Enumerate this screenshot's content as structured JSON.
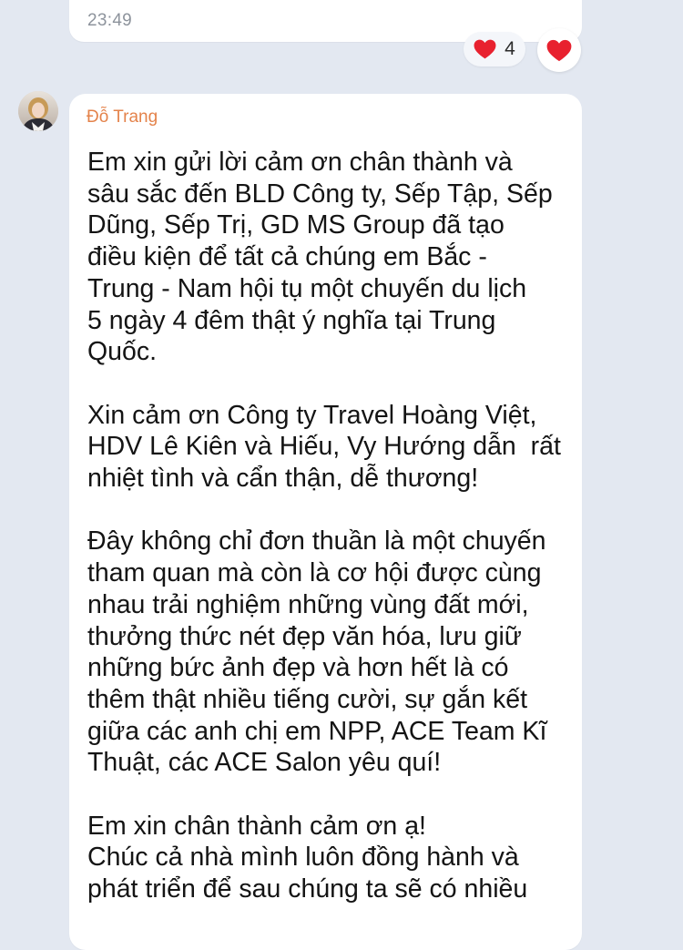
{
  "previous_message": {
    "time": "23:49",
    "reaction": {
      "emoji": "❤",
      "count": "4"
    }
  },
  "message": {
    "sender": "Đỗ Trang",
    "text": "Em xin gửi lời cảm ơn chân thành và\nsâu sắc đến BLD Công ty, Sếp Tập, Sếp\nDũng, Sếp Trị, GD MS Group đã tạo\nđiều kiện để tất cả chúng em Bắc -\nTrung - Nam hội tụ một chuyến du lịch\n5 ngày 4 đêm thật ý nghĩa tại Trung\nQuốc.\n\nXin cảm ơn Công ty Travel Hoàng Việt,\nHDV Lê Kiên và Hiếu, Vy Hướng dẫn  rất\nnhiệt tình và cẩn thận, dễ thương!\n\nĐây không chỉ đơn thuần là một chuyến\ntham quan mà còn là cơ hội được cùng\nnhau trải nghiệm những vùng đất mới,\nthưởng thức nét đẹp văn hóa, lưu giữ\nnhững bức ảnh đẹp và hơn hết là có\nthêm thật nhiều tiếng cười, sự gắn kết\ngiữa các anh chị em NPP, ACE Team Kĩ\nThuật, các ACE Salon yêu quí!\n\nEm xin chân thành cảm ơn ạ!\nChúc cả nhà mình luôn đồng hành và\nphát triển để sau chúng ta sẽ có nhiều"
  },
  "colors": {
    "background": "#e3e8f1",
    "bubble": "#ffffff",
    "sender_name": "#e4834b",
    "heart": "#e8212f",
    "timestamp": "#8d939c"
  },
  "icons": {
    "reaction_heart": "heart-icon",
    "react_button": "heart-icon"
  }
}
